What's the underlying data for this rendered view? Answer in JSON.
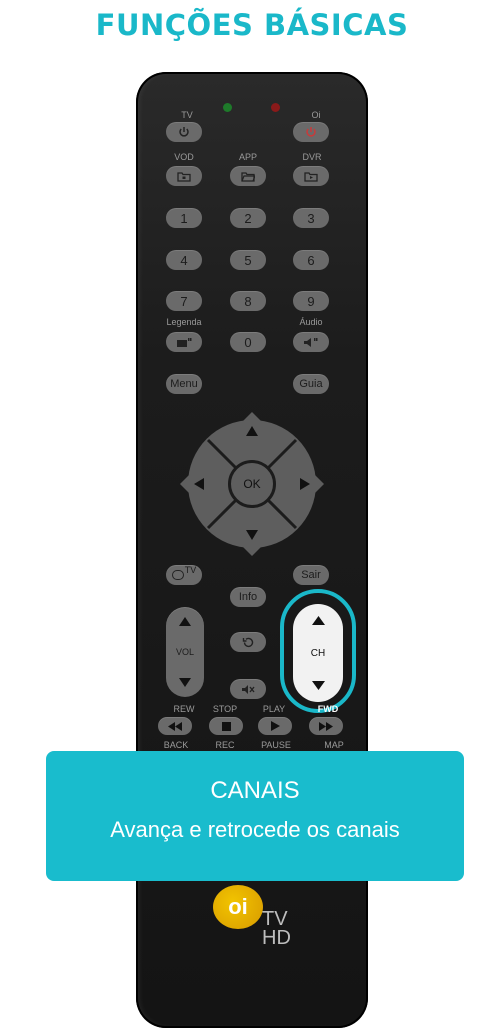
{
  "page": {
    "title": "FUNÇÕES BÁSICAS"
  },
  "remote": {
    "labels": {
      "tv": "TV",
      "oi": "Oi",
      "vod": "VOD",
      "app": "APP",
      "dvr": "DVR",
      "legenda": "Legenda",
      "audio": "Áudio",
      "rew": "REW",
      "stop": "STOP",
      "play": "PLAY",
      "fwd": "FWD",
      "back": "BACK",
      "rec": "REC",
      "pause": "PAUSE",
      "map": "MAP"
    },
    "numbers": [
      "1",
      "2",
      "3",
      "4",
      "5",
      "6",
      "7",
      "8",
      "9",
      "0"
    ],
    "buttons": {
      "menu": "Menu",
      "guia": "Guia",
      "ok": "OK",
      "tv_sup": "TV",
      "sair": "Sair",
      "info": "Info",
      "vol": "VOL",
      "ch": "CH"
    },
    "brand": {
      "logo_text": "oi",
      "tv": "TV",
      "hd": "HD"
    },
    "led_colors": {
      "left": "#1e7a2a",
      "right": "#8a1a1a"
    },
    "icons": [
      "power-icon",
      "folder-icon",
      "subtitle-icon",
      "audio-icon",
      "arrow-up-icon",
      "arrow-down-icon",
      "arrow-left-icon",
      "arrow-right-icon",
      "replay-icon",
      "mute-icon",
      "rewind-icon",
      "stop-icon",
      "play-icon",
      "fast-forward-icon"
    ]
  },
  "callout": {
    "title": "CANAIS",
    "subtitle": "Avança e retrocede os canais"
  },
  "accent_color": "#1ab8c9"
}
